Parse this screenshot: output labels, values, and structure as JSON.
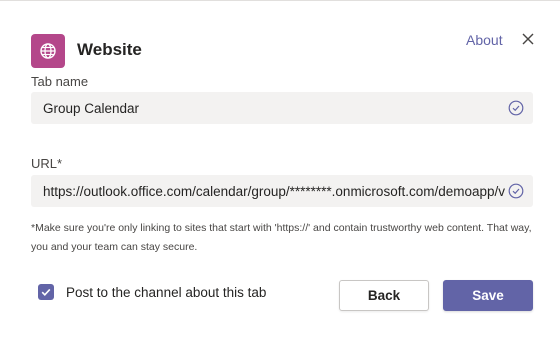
{
  "dialog": {
    "app_icon": "globe-icon",
    "title": "Website",
    "about_label": "About",
    "close_icon": "close-icon"
  },
  "tab_name": {
    "label": "Tab name",
    "value": "Group Calendar",
    "status_icon": "check-circle-icon"
  },
  "url": {
    "label": "URL*",
    "value": "https://outlook.office.com/calendar/group/********.onmicrosoft.com/demoapp/view/month",
    "status_icon": "check-circle-icon"
  },
  "note": {
    "text": "*Make sure you're only linking to sites that start with 'https://' and contain trustworthy web content. That way, you and your team can stay secure."
  },
  "post_option": {
    "label": "Post to the channel about this tab",
    "checked": true
  },
  "buttons": {
    "back_label": "Back",
    "save_label": "Save"
  },
  "colors": {
    "accent": "#6264a7",
    "app_icon_bg": "#b4478a",
    "field_bg": "#f3f2f1"
  }
}
